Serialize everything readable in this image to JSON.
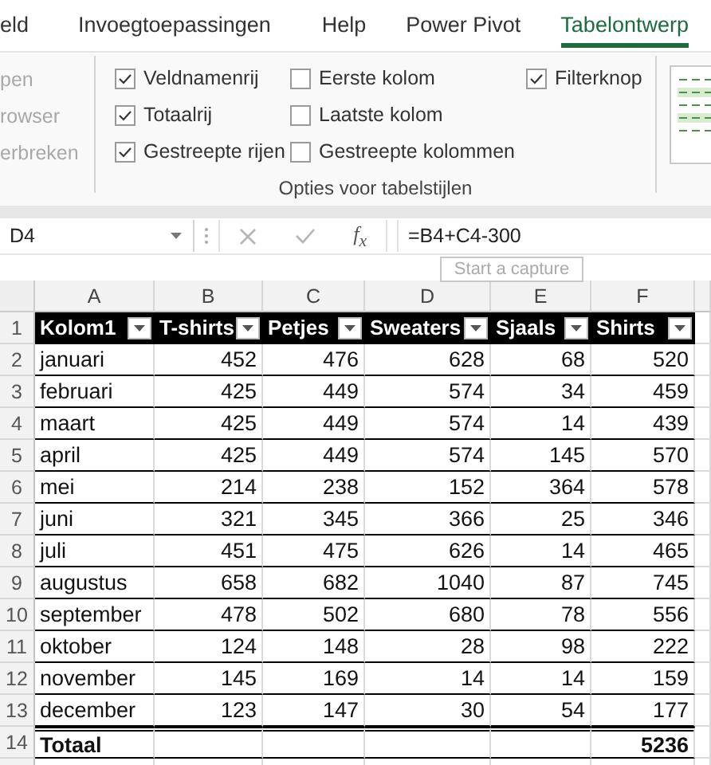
{
  "ribbon": {
    "tabs": [
      {
        "label": "eld",
        "selected": false
      },
      {
        "label": "Invoegtoepassingen",
        "selected": false
      },
      {
        "label": "Help",
        "selected": false
      },
      {
        "label": "Power Pivot",
        "selected": false
      },
      {
        "label": "Tabelontwerp",
        "selected": true
      }
    ],
    "commands": [
      {
        "label": "pen",
        "disabled": true
      },
      {
        "label": "rowser",
        "disabled": true
      },
      {
        "label": "erbreken",
        "disabled": true
      }
    ],
    "style_options": {
      "title": "Opties voor tabelstijlen",
      "columns": [
        [
          {
            "label": "Veldnamenrij",
            "checked": true
          },
          {
            "label": "Totaalrij",
            "checked": true
          },
          {
            "label": "Gestreepte rijen",
            "checked": true
          }
        ],
        [
          {
            "label": "Eerste kolom",
            "checked": false
          },
          {
            "label": "Laatste kolom",
            "checked": false
          },
          {
            "label": "Gestreepte kolommen",
            "checked": false
          }
        ],
        [
          {
            "label": "Filterknop",
            "checked": true
          }
        ]
      ]
    }
  },
  "formula_bar": {
    "name_box": "D4",
    "function_button": "f$_{x}$",
    "formula": "=B4+C4-300"
  },
  "sheet": {
    "columns": [
      "A",
      "B",
      "C",
      "D",
      "E",
      "F"
    ],
    "tooltip": "Start a capture",
    "row_numbers": [
      "1",
      "2",
      "3",
      "4",
      "5",
      "6",
      "7",
      "8",
      "9",
      "10",
      "11",
      "12",
      "13",
      "14"
    ],
    "table": {
      "headers": [
        "Kolom1",
        "T-shirts",
        "Petjes",
        "Sweaters",
        "Sjaals",
        "Shirts"
      ],
      "rows": [
        [
          "januari",
          "452",
          "476",
          "628",
          "68",
          "520"
        ],
        [
          "februari",
          "425",
          "449",
          "574",
          "34",
          "459"
        ],
        [
          "maart",
          "425",
          "449",
          "574",
          "14",
          "439"
        ],
        [
          "april",
          "425",
          "449",
          "574",
          "145",
          "570"
        ],
        [
          "mei",
          "214",
          "238",
          "152",
          "364",
          "578"
        ],
        [
          "juni",
          "321",
          "345",
          "366",
          "25",
          "346"
        ],
        [
          "juli",
          "451",
          "475",
          "626",
          "14",
          "465"
        ],
        [
          "augustus",
          "658",
          "682",
          "1040",
          "87",
          "745"
        ],
        [
          "september",
          "478",
          "502",
          "680",
          "78",
          "556"
        ],
        [
          "oktober",
          "124",
          "148",
          "28",
          "98",
          "222"
        ],
        [
          "november",
          "145",
          "169",
          "14",
          "14",
          "159"
        ],
        [
          "december",
          "123",
          "147",
          "30",
          "54",
          "177"
        ]
      ],
      "total": {
        "label": "Totaal",
        "value": "5236"
      }
    }
  }
}
